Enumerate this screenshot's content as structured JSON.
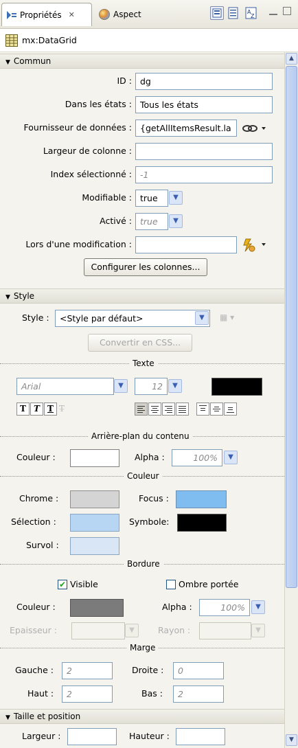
{
  "tabs": {
    "properties": "Propriétés",
    "appearance": "Aspect"
  },
  "component": "mx:DataGrid",
  "sections": {
    "common": "Commun",
    "style": "Style",
    "size": "Taille et position"
  },
  "common": {
    "id_label": "ID :",
    "id_value": "dg",
    "states_label": "Dans les états :",
    "states_value": "Tous les états",
    "provider_label": "Fournisseur de données :",
    "provider_value": "{getAllItemsResult.la",
    "colwidth_label": "Largeur de colonne :",
    "colwidth_value": "",
    "selindex_label": "Index sélectionné :",
    "selindex_placeholder": "-1",
    "editable_label": "Modifiable :",
    "editable_value": "true",
    "enabled_label": "Activé :",
    "enabled_value": "true",
    "onchange_label": "Lors d'une modification :",
    "onchange_value": "",
    "configure_button": "Configurer les colonnes..."
  },
  "style": {
    "style_label": "Style :",
    "style_value": "<Style par défaut>",
    "convert_button": "Convertir en CSS...",
    "text_group": "Texte",
    "font_value": "Arial",
    "size_value": "12",
    "text_color": "#000000",
    "bg_group": "Arrière-plan du contenu",
    "bg_color_label": "Couleur :",
    "bg_color": "#ffffff",
    "bg_alpha_label": "Alpha :",
    "bg_alpha_value": "100%",
    "color_group": "Couleur",
    "chrome_label": "Chrome :",
    "chrome_color": "#d4d4d4",
    "focus_label": "Focus :",
    "focus_color": "#7fbcf0",
    "selection_label": "Sélection :",
    "selection_color": "#b6d6f4",
    "symbol_label": "Symbole:",
    "symbol_color": "#000000",
    "hover_label": "Survol :",
    "hover_color": "#d8e6f6",
    "border_group": "Bordure",
    "visible_label": "Visible",
    "visible_checked": true,
    "shadow_label": "Ombre portée",
    "shadow_checked": false,
    "border_color_label": "Couleur :",
    "border_color": "#7b7b7b",
    "border_alpha_label": "Alpha :",
    "border_alpha_value": "100%",
    "thickness_label": "Epaisseur :",
    "radius_label": "Rayon :",
    "margin_group": "Marge",
    "left_label": "Gauche :",
    "left_value": "2",
    "right_label": "Droite :",
    "right_value": "0",
    "top_label": "Haut :",
    "top_value": "2",
    "bottom_label": "Bas :",
    "bottom_value": "2"
  },
  "size": {
    "width_label": "Largeur :",
    "height_label": "Hauteur :"
  }
}
